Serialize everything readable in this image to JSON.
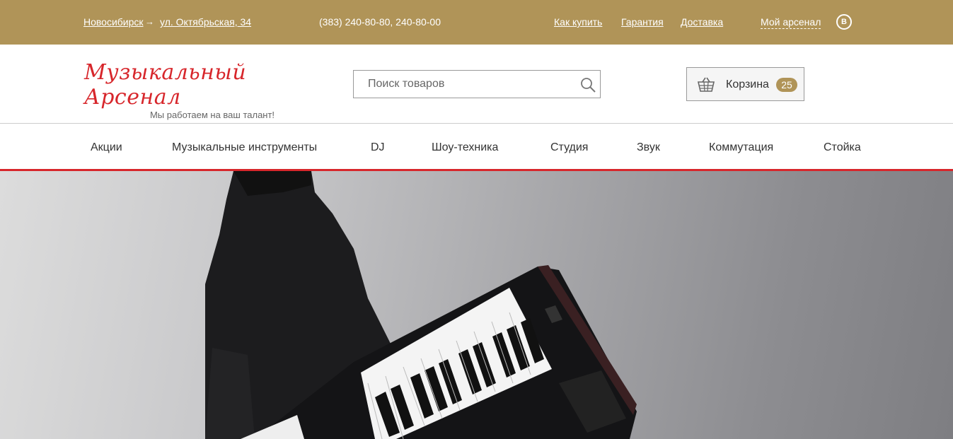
{
  "topbar": {
    "city": "Новосибирск",
    "arrow": "→",
    "street": "ул. Октябрьская, 34",
    "phones": "(383) 240-80-80, 240-80-00",
    "links": [
      "Как купить",
      "Гарантия",
      "Доставка"
    ],
    "account": "Мой арсенал",
    "social_label": "В"
  },
  "header": {
    "logo_title": "Музыкальный Арсенал",
    "logo_tagline": "Мы работаем на ваш талант!",
    "search_placeholder": "Поиск товаров",
    "cart_label": "Корзина",
    "cart_count": "25"
  },
  "nav": {
    "items": [
      "Акции",
      "Музыкальные инструменты",
      "DJ",
      "Шоу-техника",
      "Студия",
      "Звук",
      "Коммутация",
      "Стойка"
    ]
  },
  "colors": {
    "brand_gold": "#b09458",
    "accent_red": "#d7262b"
  },
  "icons": [
    "search-icon",
    "basket-icon",
    "vk-icon"
  ]
}
